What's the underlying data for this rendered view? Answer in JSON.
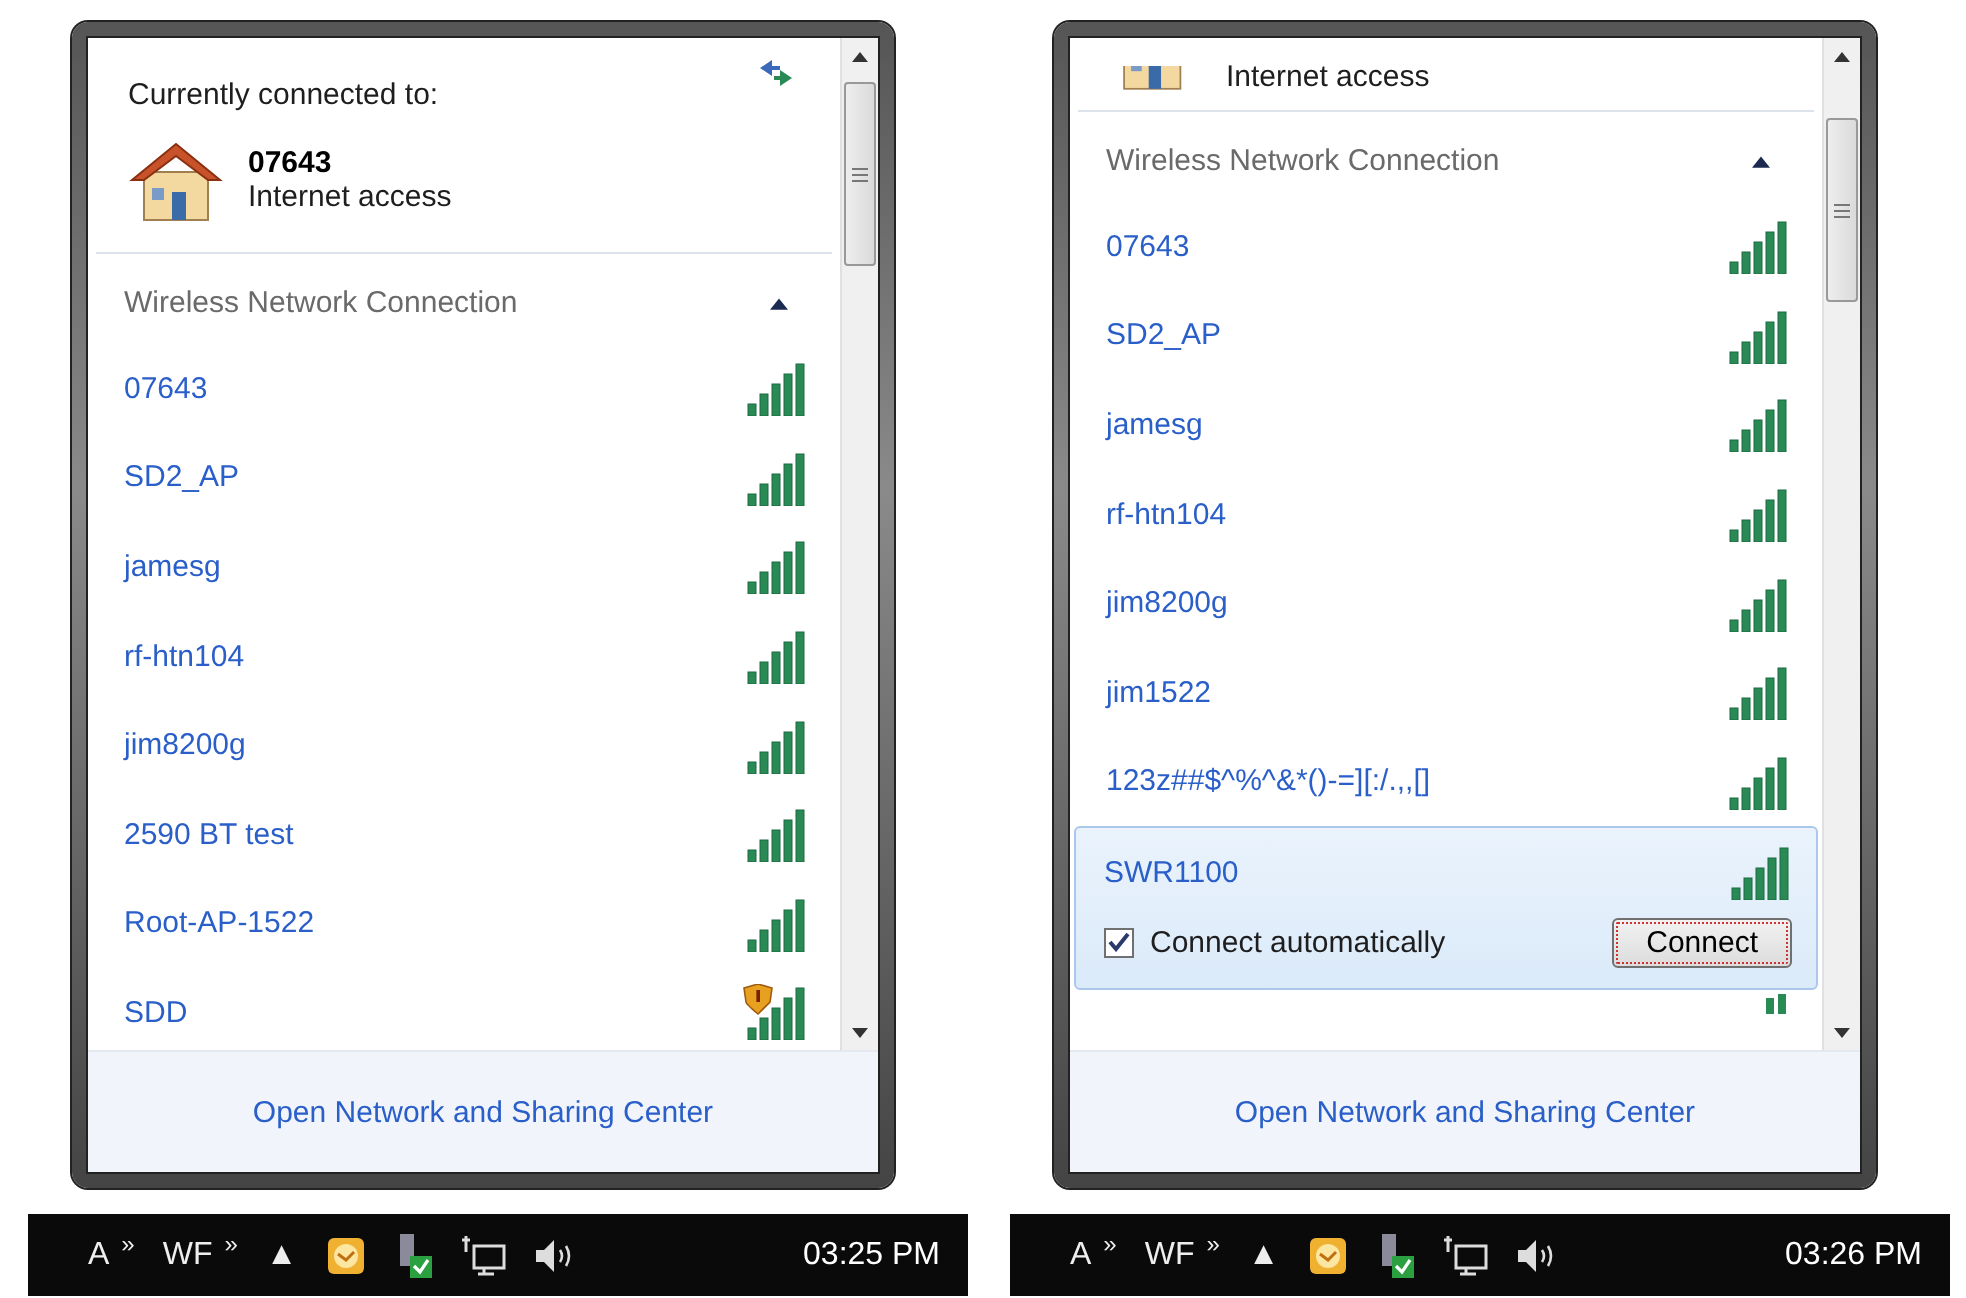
{
  "panels": [
    {
      "connected": {
        "heading": "Currently connected to:",
        "name": "07643",
        "status": "Internet access"
      },
      "section": {
        "title": "Wireless Network Connection",
        "expanded": true
      },
      "networks": [
        {
          "kind": "network",
          "name": "07643",
          "warning": false,
          "expanded": false
        },
        {
          "kind": "network",
          "name": "SD2_AP",
          "warning": false,
          "expanded": false
        },
        {
          "kind": "network",
          "name": "jamesg",
          "warning": false,
          "expanded": false
        },
        {
          "kind": "network",
          "name": "rf-htn104",
          "warning": false,
          "expanded": false
        },
        {
          "kind": "network",
          "name": "jim8200g",
          "warning": false,
          "expanded": false
        },
        {
          "kind": "network",
          "name": "2590 BT test",
          "warning": false,
          "expanded": false
        },
        {
          "kind": "network",
          "name": "Root-AP-1522",
          "warning": false,
          "expanded": false
        },
        {
          "kind": "network",
          "name": "SDD",
          "warning": true,
          "expanded": false
        }
      ],
      "footer_link": "Open Network and Sharing Center",
      "taskbar": {
        "items": [
          "A",
          "»",
          "WF",
          "»",
          "▲"
        ],
        "time": "03:25 PM"
      }
    },
    {
      "connected": {
        "status": "Internet access"
      },
      "section": {
        "title": "Wireless Network Connection",
        "expanded": true
      },
      "networks": [
        {
          "kind": "network",
          "name": "07643",
          "warning": false,
          "expanded": false
        },
        {
          "kind": "network",
          "name": "SD2_AP",
          "warning": false,
          "expanded": false
        },
        {
          "kind": "network",
          "name": "jamesg",
          "warning": false,
          "expanded": false
        },
        {
          "kind": "network",
          "name": "rf-htn104",
          "warning": false,
          "expanded": false
        },
        {
          "kind": "network",
          "name": "jim8200g",
          "warning": false,
          "expanded": false
        },
        {
          "kind": "network",
          "name": "jim1522",
          "warning": false,
          "expanded": false
        },
        {
          "kind": "network",
          "name": "123z##$^%^&*()-=][:/.,,[]",
          "warning": false,
          "expanded": false
        },
        {
          "kind": "network",
          "name": "SWR1100",
          "warning": false,
          "expanded": true,
          "auto_label": "Connect automatically",
          "auto_checked": true,
          "button": "Connect"
        },
        {
          "kind": "cut_off"
        }
      ],
      "footer_link": "Open Network and Sharing Center",
      "taskbar": {
        "items": [
          "A",
          "»",
          "WF",
          "»",
          "▲"
        ],
        "time": "03:26 PM"
      }
    }
  ]
}
